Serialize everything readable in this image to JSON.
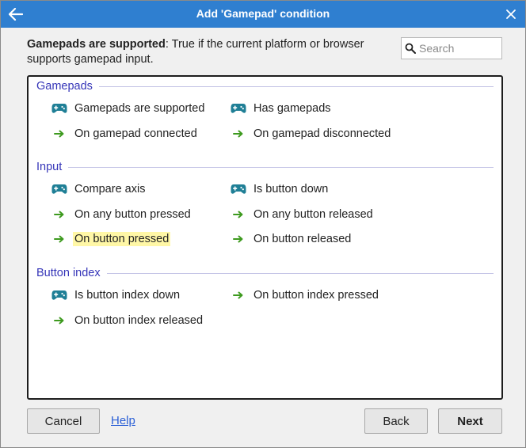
{
  "window": {
    "title": "Add 'Gamepad' condition",
    "titlebar_color": "#2f7fd0"
  },
  "description": {
    "bold": "Gamepads are supported",
    "text": ": True if the current platform or browser supports gamepad input."
  },
  "search": {
    "placeholder": "Search",
    "value": ""
  },
  "groups": [
    {
      "title": "Gamepads",
      "items": [
        {
          "label": "Gamepads are supported",
          "icon": "gamepad-icon"
        },
        {
          "label": "Has gamepads",
          "icon": "gamepad-icon"
        },
        {
          "label": "On gamepad connected",
          "icon": "arrow-right-icon"
        },
        {
          "label": "On gamepad disconnected",
          "icon": "arrow-right-icon"
        }
      ]
    },
    {
      "title": "Input",
      "items": [
        {
          "label": "Compare axis",
          "icon": "gamepad-icon"
        },
        {
          "label": "Is button down",
          "icon": "gamepad-icon"
        },
        {
          "label": "On any button pressed",
          "icon": "arrow-right-icon"
        },
        {
          "label": "On any button released",
          "icon": "arrow-right-icon"
        },
        {
          "label": "On button pressed",
          "icon": "arrow-right-icon",
          "highlighted": true
        },
        {
          "label": "On button released",
          "icon": "arrow-right-icon"
        }
      ]
    },
    {
      "title": "Button index",
      "items": [
        {
          "label": "Is button index down",
          "icon": "gamepad-icon"
        },
        {
          "label": "On button index pressed",
          "icon": "arrow-right-icon"
        },
        {
          "label": "On button index released",
          "icon": "arrow-right-icon"
        }
      ]
    }
  ],
  "footer": {
    "cancel": "Cancel",
    "help": "Help",
    "back": "Back",
    "next": "Next"
  },
  "colors": {
    "gamepad_icon": "#1f7f96",
    "arrow_icon": "#3e9a1f",
    "highlight": "#fff7a6",
    "group_title": "#3535b8"
  }
}
